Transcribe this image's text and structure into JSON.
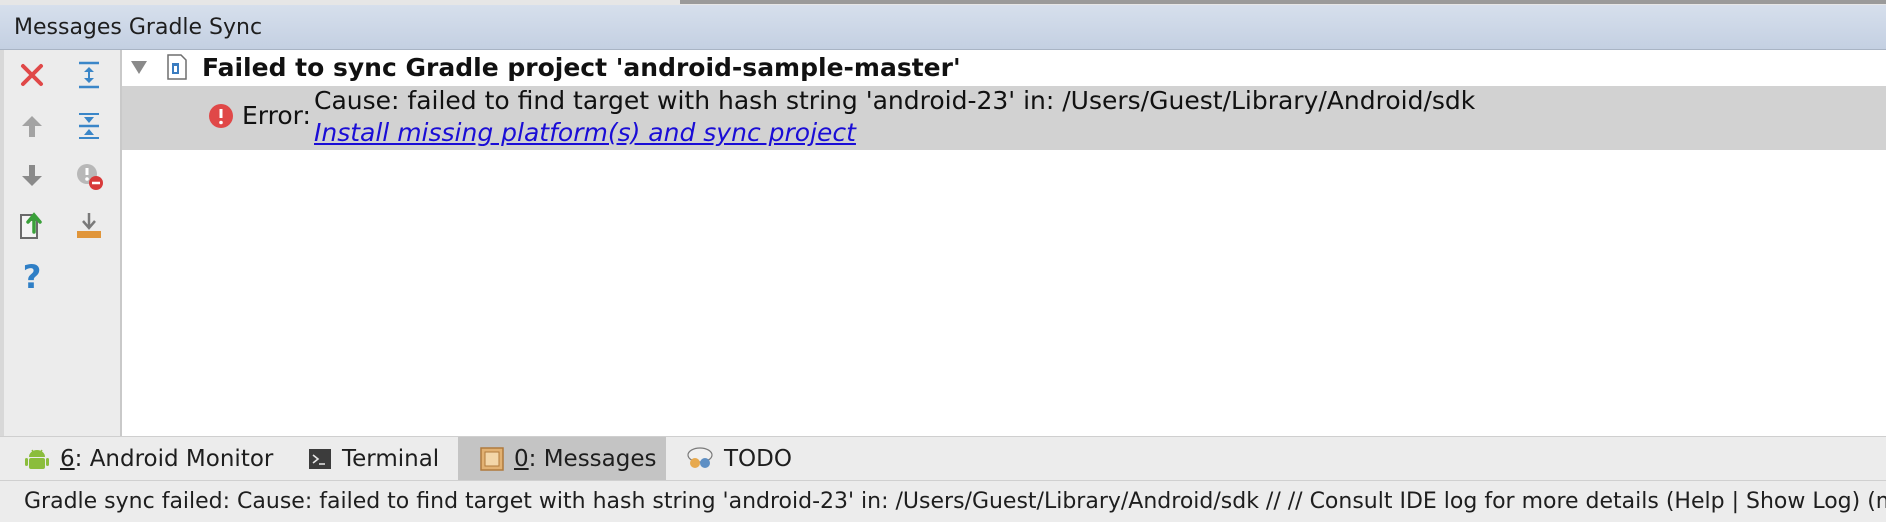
{
  "panel": {
    "title": "Messages Gradle Sync"
  },
  "toolbar": {
    "icons": [
      "close-icon",
      "arrow-up-icon",
      "arrow-down-icon",
      "export-icon",
      "help-icon",
      "expand-all-icon",
      "collapse-all-icon",
      "hide-warnings-icon",
      "download-icon"
    ]
  },
  "tree": {
    "root_label": "Failed to sync Gradle project 'android-sample-master'",
    "error": {
      "prefix": "Error:",
      "message": "Cause: failed to find target with hash string 'android-23' in: /Users/Guest/Library/Android/sdk",
      "link": "Install missing platform(s) and sync project"
    }
  },
  "tabs": [
    {
      "key": "6",
      "rest": ": Android Monitor",
      "icon": "android-icon",
      "active": false
    },
    {
      "key": "",
      "rest": "Terminal",
      "icon": "terminal-icon",
      "active": false
    },
    {
      "key": "0",
      "rest": ": Messages",
      "icon": "messages-icon",
      "active": true
    },
    {
      "key": "",
      "rest": "TODO",
      "icon": "todo-icon",
      "active": false
    }
  ],
  "status": {
    "text": "Gradle sync failed: Cause: failed to find target with hash string 'android-23' in: /Users/Guest/Library/Android/sdk // // Consult IDE log for more details (Help | Show Log) (m"
  },
  "colors": {
    "error": "#e04848",
    "link": "#1a0dd6",
    "accent": "#2f7fc6",
    "android": "#8bbd3c",
    "selected_row": "#d2d2d2"
  }
}
